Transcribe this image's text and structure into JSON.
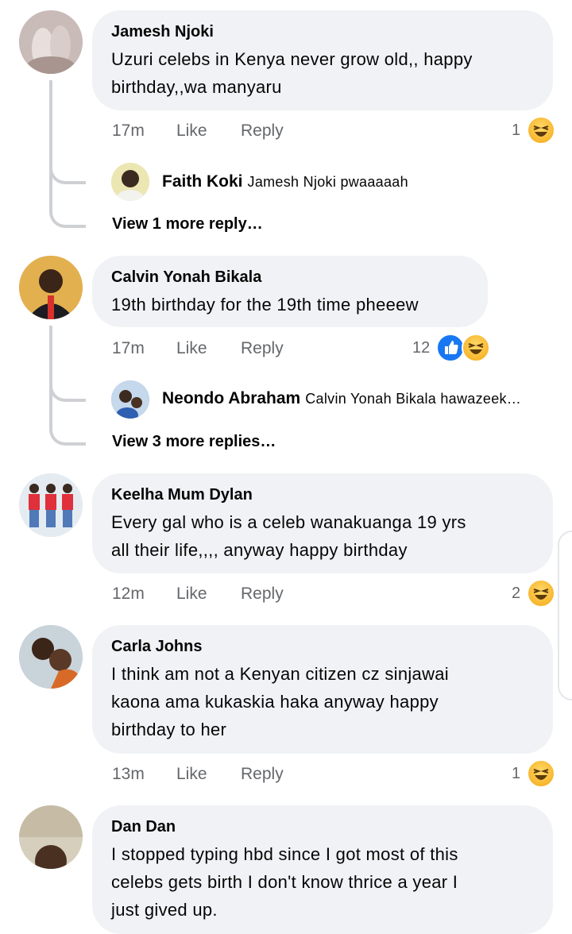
{
  "comments": [
    {
      "author": "Jamesh Njoki",
      "lines": [
        "Uzuri celebs in Kenya never grow old,, happy",
        "birthday,,wa manyaru"
      ],
      "time": "17m",
      "like": "Like",
      "reply": "Reply",
      "reaction_count": "1",
      "reactions": [
        "haha-icon"
      ],
      "replies": [
        {
          "author": "Faith Koki",
          "text": "Jamesh Njoki pwaaaaah"
        }
      ],
      "view_more": "View 1 more reply…"
    },
    {
      "author": "Calvin Yonah Bikala",
      "lines": [
        "19th birthday for the 19th time pheeew"
      ],
      "time": "17m",
      "like": "Like",
      "reply": "Reply",
      "reaction_count": "12",
      "reactions": [
        "like-icon",
        "haha-icon"
      ],
      "replies": [
        {
          "author": "Neondo Abraham",
          "text": "Calvin Yonah Bikala hawazeek…"
        }
      ],
      "view_more": "View 3 more replies…"
    },
    {
      "author": "Keelha Mum Dylan",
      "lines": [
        "Every gal who is a celeb wanakuanga 19 yrs",
        "all their life,,,, anyway happy birthday"
      ],
      "time": "12m",
      "like": "Like",
      "reply": "Reply",
      "reaction_count": "2",
      "reactions": [
        "haha-icon"
      ]
    },
    {
      "author": "Carla Johns",
      "lines": [
        "I think am not a Kenyan citizen cz sinjawai",
        "kaona ama kukaskia haka anyway happy",
        "birthday to her"
      ],
      "time": "13m",
      "like": "Like",
      "reply": "Reply",
      "reaction_count": "1",
      "reactions": [
        "haha-icon"
      ]
    },
    {
      "author": "Dan Dan",
      "lines": [
        "I stopped typing hbd since I got most of this",
        "celebs gets birth I don't know thrice a year I",
        "just gived up."
      ]
    }
  ],
  "colors": {
    "bubble": "#f0f2f5",
    "meta_text": "#65676b",
    "like_blue": "#1877f2",
    "haha_yellow": "#f7b125",
    "thread_line": "#ced0d4"
  }
}
